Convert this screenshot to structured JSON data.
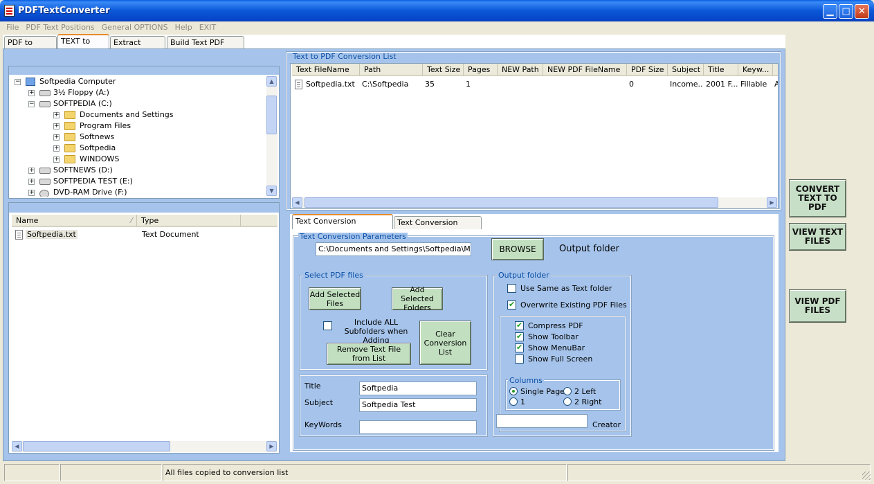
{
  "window": {
    "title": "PDFTextConverter"
  },
  "menu": [
    "File",
    "PDF Text Positions",
    "General OPTIONS",
    "Help",
    "EXIT"
  ],
  "tabs": [
    "PDF to TEXT",
    "TEXT to PDF",
    "Extract Images",
    "Build Text  PDF Page"
  ],
  "tree": {
    "items": [
      {
        "label": "Softpedia Computer",
        "icon": "computer-icon"
      },
      {
        "label": "3½ Floppy (A:)",
        "icon": "floppy-icon"
      },
      {
        "label": "SOFTPEDIA (C:)",
        "icon": "drive-icon"
      },
      {
        "label": "Documents and Settings",
        "icon": "folder-icon"
      },
      {
        "label": "Program Files",
        "icon": "folder-icon"
      },
      {
        "label": "Softnews",
        "icon": "folder-icon"
      },
      {
        "label": "Softpedia",
        "icon": "folder-icon"
      },
      {
        "label": "WINDOWS",
        "icon": "folder-icon"
      },
      {
        "label": "SOFTNEWS (D:)",
        "icon": "drive-icon"
      },
      {
        "label": "SOFTPEDIA TEST (E:)",
        "icon": "drive-icon"
      },
      {
        "label": "DVD-RAM Drive (F:)",
        "icon": "dvd-icon"
      }
    ]
  },
  "files": {
    "columns": [
      "Name",
      "Type"
    ],
    "rows": [
      {
        "name": "Softpedia.txt",
        "type": "Text Document"
      }
    ]
  },
  "conversion_list": {
    "title": "Text to PDF Conversion List",
    "columns": [
      "Text FileName",
      "Path",
      "Text Size",
      "Pages",
      "NEW Path",
      "NEW PDF FileName",
      "PDF Size",
      "Subject",
      "Title",
      "Keyw..."
    ],
    "rows": [
      [
        "Softpedia.txt",
        "C:\\Softpedia",
        "35",
        "1",
        "",
        "",
        "0",
        "Income...",
        "2001 F...",
        "Fillable",
        "A"
      ]
    ]
  },
  "subtabs": [
    "Text Conversion Parameters",
    "Text Conversion Settings"
  ],
  "params": {
    "group_title": "Text Conversion Parameters",
    "folder_path": "C:\\Documents and Settings\\Softpedia\\My Doc",
    "browse_label": "BROWSE",
    "output_folder_label": "Output folder",
    "select_pdf_files": {
      "title": "Select PDF files",
      "add_files": "Add Selected Files",
      "add_folders": "Add Selected Folders",
      "include_subfolders": "Include ALL Subfolders when Adding",
      "remove_file": "Remove Text File from List",
      "clear_list": "Clear Conversion List"
    },
    "meta": {
      "title_label": "Title",
      "title_value": "Softpedia",
      "subject_label": "Subject",
      "subject_value": "Softpedia Test",
      "keywords_label": "KeyWords",
      "keywords_value": ""
    },
    "output": {
      "title": "Output folder",
      "use_same": "Use Same as Text folder",
      "use_same_checked": false,
      "overwrite": "Overwrite Existing PDF Files",
      "overwrite_checked": true,
      "compress": "Compress PDF",
      "compress_checked": true,
      "show_toolbar": "Show Toolbar",
      "show_toolbar_checked": true,
      "show_menubar": "Show MenuBar",
      "show_menubar_checked": true,
      "show_fullscreen": "Show Full Screen",
      "show_fullscreen_checked": false,
      "columns_title": "Columns",
      "columns_options": [
        "Single Page",
        "2 Left",
        "1",
        "2 Right"
      ],
      "columns_selected": "Single Page",
      "creator_label": "Creator",
      "creator_value": ""
    }
  },
  "side_buttons": {
    "convert": "CONVERT TEXT TO PDF",
    "view_text": "VIEW TEXT FILES",
    "view_pdf": "VIEW PDF FILES"
  },
  "status": {
    "message": "All files copied to conversion list"
  }
}
